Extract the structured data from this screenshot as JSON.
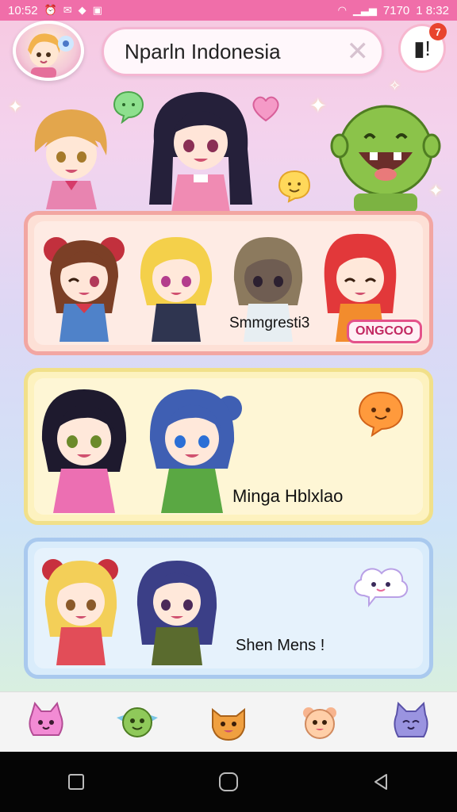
{
  "status_bar": {
    "time_left": "10:52",
    "time_right": "1 8:32",
    "battery_text": "7170"
  },
  "header": {
    "search_text": "Nparln Indonesia",
    "notification_count": "7"
  },
  "cards": [
    {
      "label": "Smmgresti3",
      "badge": "ONGCOO"
    },
    {
      "label": "Minga Hblxlao"
    },
    {
      "label": "Shen Mens !"
    }
  ],
  "bottom_nav": [
    {
      "icon": "pink-cat-icon"
    },
    {
      "icon": "green-dragon-icon"
    },
    {
      "icon": "orange-fox-icon"
    },
    {
      "icon": "peach-bear-icon"
    },
    {
      "icon": "purple-cat-icon"
    }
  ],
  "colors": {
    "accent": "#f06ea9",
    "card1_border": "#f2a6a2",
    "card2_border": "#f1e08a",
    "card3_border": "#a9c9ee"
  }
}
